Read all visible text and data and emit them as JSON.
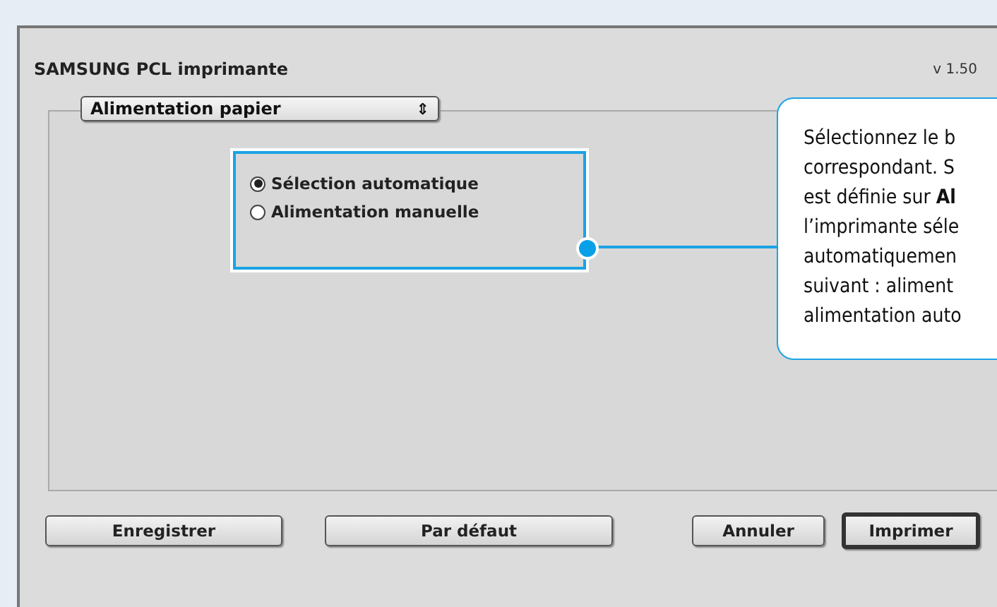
{
  "window": {
    "title": "SAMSUNG PCL imprimante",
    "version": "v 1.50"
  },
  "popup": {
    "value": "Alimentation papier",
    "arrows": "⇕"
  },
  "options": [
    {
      "label": "Sélection automatique",
      "selected": true
    },
    {
      "label": "Alimentation manuelle",
      "selected": false
    }
  ],
  "callout": {
    "lines": [
      "Sélectionnez le b",
      "correspondant. S",
      "est définie sur **Al**",
      "l’imprimante séle",
      "automatiquemen",
      "suivant : aliment",
      "alimentation auto"
    ]
  },
  "buttons": [
    {
      "label": "Enregistrer",
      "default": false
    },
    {
      "label": "Par défaut",
      "default": false
    },
    {
      "label": "Annuler",
      "default": false
    },
    {
      "label": "Imprimer",
      "default": true
    }
  ]
}
